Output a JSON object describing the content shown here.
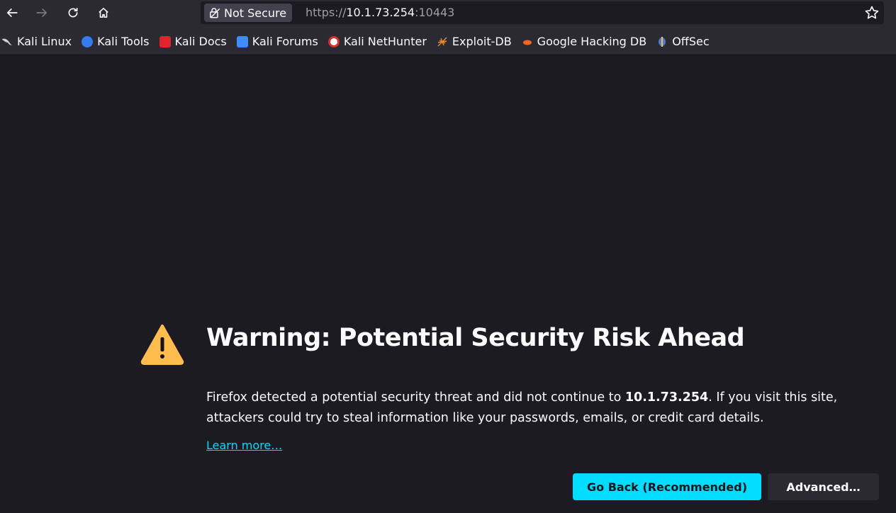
{
  "toolbar": {
    "url_scheme": "https://",
    "url_host": "10.1.73.254",
    "url_port": ":10443",
    "not_secure_label": "Not Secure"
  },
  "bookmarks": [
    {
      "label": "Kali Linux",
      "icon": "kali-dragon-icon",
      "color": "#367bf0"
    },
    {
      "label": "Kali Tools",
      "icon": "kali-tools-icon",
      "color": "#367bf0"
    },
    {
      "label": "Kali Docs",
      "icon": "kali-docs-icon",
      "color": "#e0242b"
    },
    {
      "label": "Kali Forums",
      "icon": "kali-forums-icon",
      "color": "#3d8bfd"
    },
    {
      "label": "Kali NetHunter",
      "icon": "kali-nethunter-icon",
      "color": "#d7302c"
    },
    {
      "label": "Exploit-DB",
      "icon": "exploit-db-icon",
      "color": "#e88f23"
    },
    {
      "label": "Google Hacking DB",
      "icon": "ghdb-icon",
      "color": "#f26522"
    },
    {
      "label": "OffSec",
      "icon": "offsec-icon",
      "color": "#4d7bd8"
    }
  ],
  "main": {
    "title": "Warning: Potential Security Risk Ahead",
    "desc_before": "Firefox detected a potential security threat and did not continue to ",
    "desc_host": "10.1.73.254",
    "desc_after": ". If you visit this site, attackers could try to steal information like your passwords, emails, or credit card details.",
    "learn_more": "Learn more…",
    "go_back": "Go Back (Recommended)",
    "advanced": "Advanced…"
  },
  "colors": {
    "accent": "#00ddff",
    "warning": "#ffbd4f",
    "background": "#1c1b22"
  }
}
